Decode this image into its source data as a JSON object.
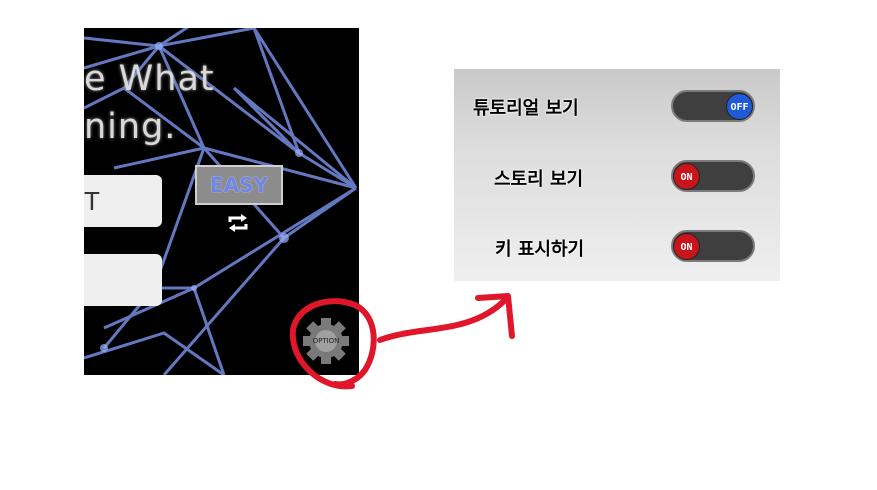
{
  "game_screen": {
    "title_line_1": "e What",
    "title_line_2": "ning.",
    "input_1_value": "T",
    "input_2_value": "",
    "difficulty_button": "EASY",
    "repeat_icon": "repeat-icon",
    "option_icon": "gear-icon",
    "option_label": "OPTION"
  },
  "options_panel": {
    "items": [
      {
        "label": "튜토리얼 보기",
        "state": "OFF"
      },
      {
        "label": "스토리 보기",
        "state": "ON"
      },
      {
        "label": "키 표시하기",
        "state": "ON"
      }
    ]
  },
  "colors": {
    "game_background": "#000000",
    "web_lines": "#7086d6",
    "annotation": "#e0162b",
    "toggle_on": "#c8151b",
    "toggle_off": "#1f5bd8"
  }
}
